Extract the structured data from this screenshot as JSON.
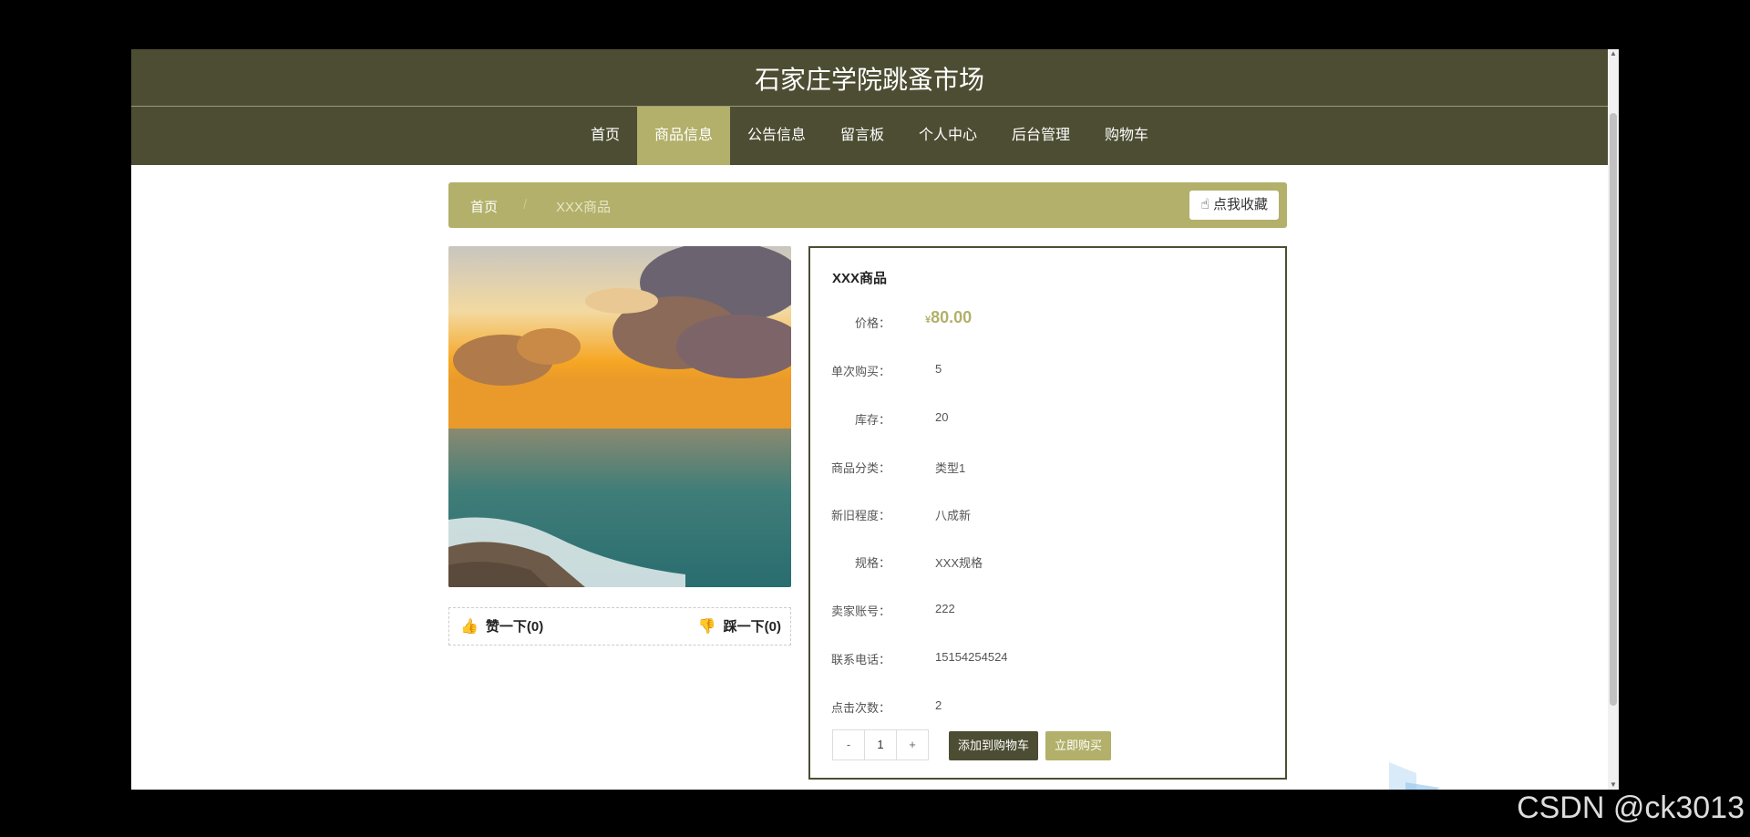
{
  "header": {
    "title": "石家庄学院跳蚤市场"
  },
  "nav": {
    "items": [
      {
        "label": "首页",
        "active": false
      },
      {
        "label": "商品信息",
        "active": true
      },
      {
        "label": "公告信息",
        "active": false
      },
      {
        "label": "留言板",
        "active": false
      },
      {
        "label": "个人中心",
        "active": false
      },
      {
        "label": "后台管理",
        "active": false
      },
      {
        "label": "购物车",
        "active": false
      }
    ]
  },
  "breadcrumb": {
    "home": "首页",
    "separator": "/",
    "current": "XXX商品",
    "collect_label": "点我收藏"
  },
  "product": {
    "name": "XXX商品",
    "currency": "¥",
    "price": "80.00",
    "price_label": "价格：",
    "rows": [
      {
        "label": "单次购买：",
        "value": "5"
      },
      {
        "label": "库存：",
        "value": "20"
      },
      {
        "label": "商品分类：",
        "value": "类型1"
      },
      {
        "label": "新旧程度：",
        "value": "八成新"
      },
      {
        "label": "规格：",
        "value": "XXX规格"
      },
      {
        "label": "卖家账号：",
        "value": "222"
      },
      {
        "label": "联系电话：",
        "value": "15154254524"
      },
      {
        "label": "点击次数：",
        "value": "2"
      }
    ],
    "quantity": {
      "minus": "-",
      "value": "1",
      "plus": "+"
    },
    "add_to_cart_label": "添加到购物车",
    "buy_now_label": "立即购买"
  },
  "votes": {
    "up_label": "赞一下(0)",
    "down_label": "踩一下(0)"
  },
  "watermark": "CSDN @ck3013",
  "colors": {
    "header_bg": "#4d4d33",
    "accent": "#b2b06a"
  }
}
